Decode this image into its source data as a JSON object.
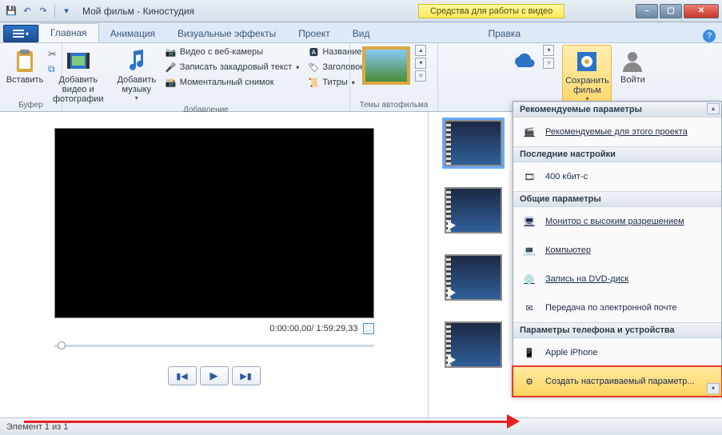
{
  "titlebar": {
    "title": "Мой фильм - Киностудия",
    "context_tab": "Средства для работы с видео"
  },
  "window_controls": {
    "min": "–",
    "max": "▢",
    "close": "✕"
  },
  "ribbon": {
    "tabs": [
      "Главная",
      "Анимация",
      "Визуальные эффекты",
      "Проект",
      "Вид",
      "Правка"
    ],
    "groups": {
      "buffer": {
        "label": "Буфер",
        "paste": "Вставить"
      },
      "add": {
        "label": "Добавление",
        "add_video": "Добавить видео и фотографии",
        "add_music": "Добавить музыку",
        "webcam": "Видео с веб-камеры",
        "narration": "Записать закадровый текст",
        "snapshot": "Моментальный снимок",
        "title": "Название",
        "caption": "Заголовок",
        "credits": "Титры"
      },
      "themes": {
        "label": "Темы автофильма"
      },
      "save": {
        "save_movie": "Сохранить фильм",
        "signin": "Войти"
      }
    }
  },
  "dropdown": {
    "sections": {
      "recommended_hdr": "Рекомендуемые параметры",
      "recommended_item": "Рекомендуемые для этого проекта",
      "recent_hdr": "Последние настройки",
      "recent_item": "400 кбит-с",
      "common_hdr": "Общие параметры",
      "hd": "Монитор с высоким разрешением",
      "computer": "Компьютер",
      "dvd": "Запись на DVD-диск",
      "email": "Передача по электронной почте",
      "phone_hdr": "Параметры телефона и устройства",
      "iphone": "Apple iPhone",
      "custom": "Создать настраиваемый параметр..."
    }
  },
  "preview": {
    "time": "0:00:00,00/ 1:59:29,33"
  },
  "status": {
    "text": "Элемент 1 из 1"
  }
}
